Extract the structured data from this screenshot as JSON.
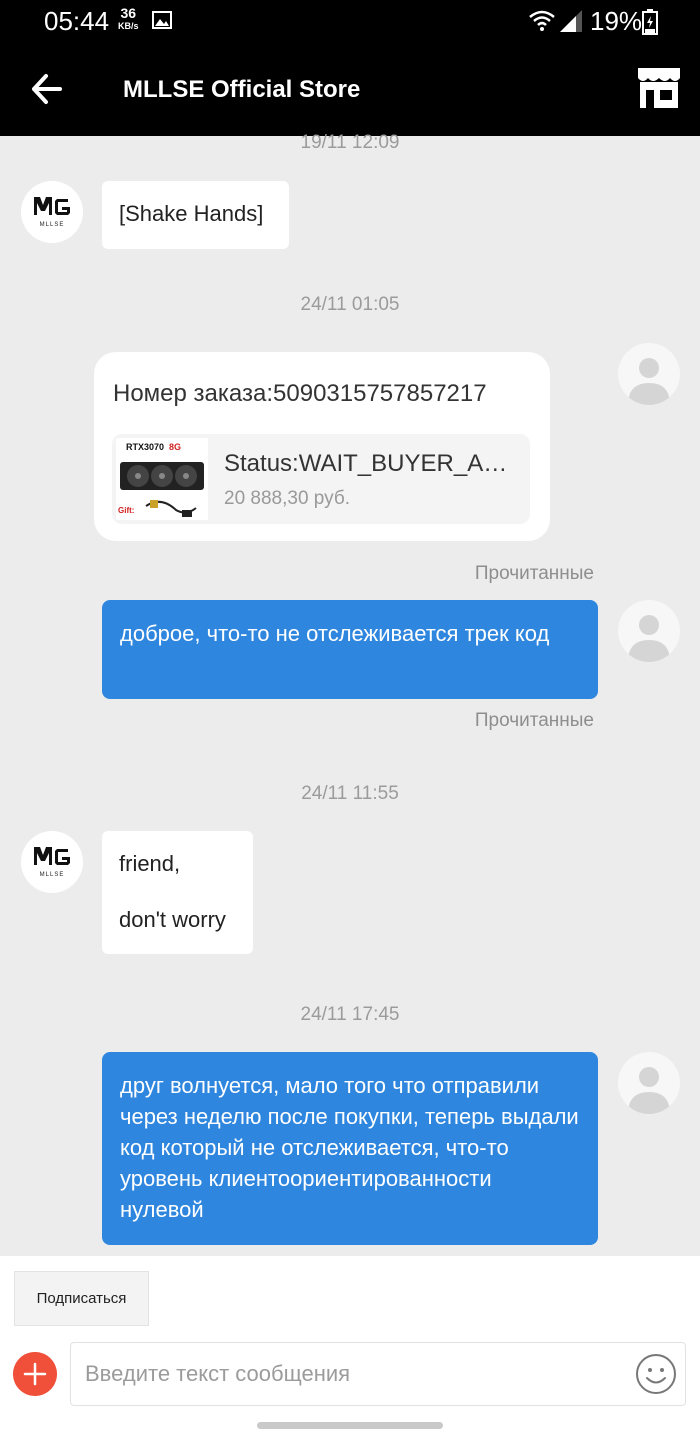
{
  "status_bar": {
    "time": "05:44",
    "speed_value": "36",
    "speed_unit": "KB/s",
    "battery": "19%"
  },
  "header": {
    "title": "MLLSE Official Store"
  },
  "chat": {
    "ts1": "19/11 12:09",
    "msg_shake": "[Shake Hands]",
    "ts2": "24/11 01:05",
    "order": {
      "number_label": "Номер заказа:5090315757857217",
      "status": "Status:WAIT_BUYER_ACCEPT_GOODS",
      "price": "20 888,30 руб.",
      "thumb_title": "RTX3070",
      "thumb_mem": "8G",
      "thumb_gift": "Gift:"
    },
    "read1": "Прочитанные",
    "msg_out1": "доброе, что-то не отслеживается трек код",
    "read2": "Прочитанные",
    "ts3": "24/11 11:55",
    "msg_in_line1": "friend,",
    "msg_in_line2": "don't worry",
    "ts4": "24/11 17:45",
    "msg_out2": "друг волнуется, мало того что отправили через неделю после покупки, теперь выдали код который не отслеживается, что-то уровень клиентоориентированности нулевой"
  },
  "bottom": {
    "subscribe_label": "Подписаться",
    "input_placeholder": "Введите текст сообщения"
  }
}
